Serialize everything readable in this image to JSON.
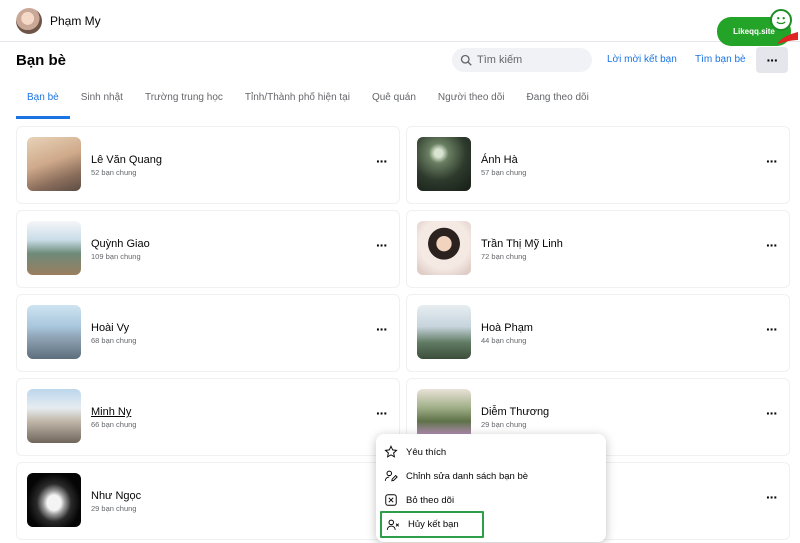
{
  "header": {
    "username": "Phạm My"
  },
  "friends": {
    "title": "Bạn bè",
    "search_placeholder": "Tìm kiếm",
    "friend_requests_label": "Lời mời kết bạn",
    "find_friends_label": "Tìm bạn bè",
    "more_label": "···"
  },
  "tabs": [
    {
      "label": "Bạn bè",
      "active": true
    },
    {
      "label": "Sinh nhật"
    },
    {
      "label": "Trường trung học"
    },
    {
      "label": "Tỉnh/Thành phố hiện tại"
    },
    {
      "label": "Quê quán"
    },
    {
      "label": "Người theo dõi"
    },
    {
      "label": "Đang theo dõi"
    }
  ],
  "cards": [
    {
      "name": "Lê Văn Quang",
      "mutual": "52 bạn chung"
    },
    {
      "name": "Ánh Hà",
      "mutual": "57 bạn chung"
    },
    {
      "name": "Quỳnh Giao",
      "mutual": "109 bạn chung"
    },
    {
      "name": "Trần Thị Mỹ Linh",
      "mutual": "72 bạn chung"
    },
    {
      "name": "Hoài Vy",
      "mutual": "68 bạn chung"
    },
    {
      "name": "Hoà Phạm",
      "mutual": "44 bạn chung"
    },
    {
      "name": "Minh Ny",
      "mutual": "66 bạn chung"
    },
    {
      "name": "Diễm Thương",
      "mutual": "29 bạn chung"
    },
    {
      "name": "Như Ngọc",
      "mutual": "29 bạn chung"
    }
  ],
  "menu": {
    "items": [
      {
        "label": "Yêu thích",
        "icon": "star-icon"
      },
      {
        "label": "Chỉnh sửa danh sách bạn bè",
        "icon": "edit-list-icon"
      },
      {
        "label": "Bỏ theo dõi",
        "icon": "unfollow-icon"
      },
      {
        "label": "Hủy kết bạn",
        "icon": "unfriend-icon"
      }
    ]
  },
  "watermark": {
    "text": "Likeqq.site"
  },
  "colors": {
    "accent": "#1b74e4",
    "highlight_border": "#2e9e4a",
    "badge": "#24a329"
  }
}
